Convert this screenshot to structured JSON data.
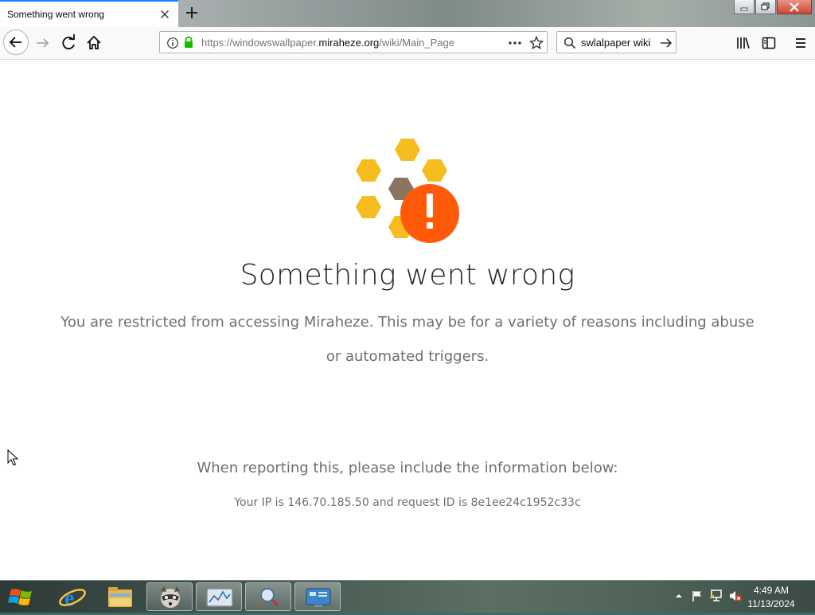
{
  "browser": {
    "tab_title": "Something went wrong",
    "url_prefix": "https://windowswallpaper.",
    "url_domain": "miraheze.org",
    "url_path": "/wiki/Main_Page",
    "search_value": "swlalpaper wiki"
  },
  "page": {
    "title": "Something went wrong",
    "description": "You are restricted from accessing Miraheze. This may be for a variety of reasons including abuse or automated triggers.",
    "report_prompt": "When reporting this, please include the information below:",
    "ip_info": "Your IP is 146.70.185.50 and request ID is 8e1ee24c1952c33c"
  },
  "taskbar": {
    "clock_time": "4:49 AM",
    "clock_date": "11/13/2024"
  },
  "colors": {
    "accent": "#0a84ff",
    "honeycomb": "#f5bd1f",
    "honeycomb_center": "#8a7561",
    "alert": "#ff5a0a"
  }
}
